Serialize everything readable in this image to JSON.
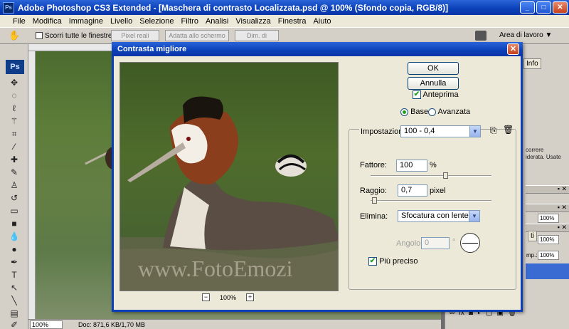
{
  "app": {
    "title": "Adobe Photoshop CS3 Extended - [Maschera di contrasto Localizzata.psd @ 100% (Sfondo copia, RGB/8)]",
    "icon_label": "Ps"
  },
  "menu": [
    "File",
    "Modifica",
    "Immagine",
    "Livello",
    "Selezione",
    "Filtro",
    "Analisi",
    "Visualizza",
    "Finestra",
    "Aiuto"
  ],
  "options_bar": {
    "scroll_all_windows_label": "Scorri tutte le finestre",
    "actual_pixels_label": "Pixel reali",
    "fit_screen_label": "Adatta allo schermo",
    "print_size_label": "Dim. di stampa",
    "workspace_label": "Area di lavoro ▼"
  },
  "toolbox": {
    "logo": "Ps"
  },
  "status_bar": {
    "zoom": "100%",
    "doc": "Doc: 871,6 KB/1,70 MB"
  },
  "right_panels": {
    "info_tab": "Info",
    "info_text": [
      "correre",
      "iderata. Usate"
    ],
    "pct1_label": "",
    "pct1_value": "100%",
    "pct2_label": "mp.:",
    "pct2_value": "100%",
    "strip_label": "ti"
  },
  "dialog": {
    "title": "Contrasta migliore",
    "ok": "OK",
    "cancel": "Annulla",
    "preview_label": "Anteprima",
    "preview_checked": true,
    "basic_label": "Base",
    "advanced_label": "Avanzata",
    "mode_selected": "Base",
    "settings_label": "Impostazioni:",
    "settings_value": "100 - 0,4",
    "amount_label": "Fattore:",
    "amount_value": "100",
    "amount_unit": "%",
    "amount_slider": 0.62,
    "radius_label": "Raggio:",
    "radius_value": "0,7",
    "radius_unit": "pixel",
    "radius_slider": 0.03,
    "remove_label": "Elimina:",
    "remove_value": "Sfocatura con lente",
    "angle_label": "Angolo:",
    "angle_value": "0",
    "angle_unit": "°",
    "more_accurate_label": "Più preciso",
    "more_accurate_checked": true,
    "zoom_value": "100%",
    "zoom_minus": "−",
    "zoom_plus": "+",
    "watermark": "www.FotoEmozi"
  }
}
